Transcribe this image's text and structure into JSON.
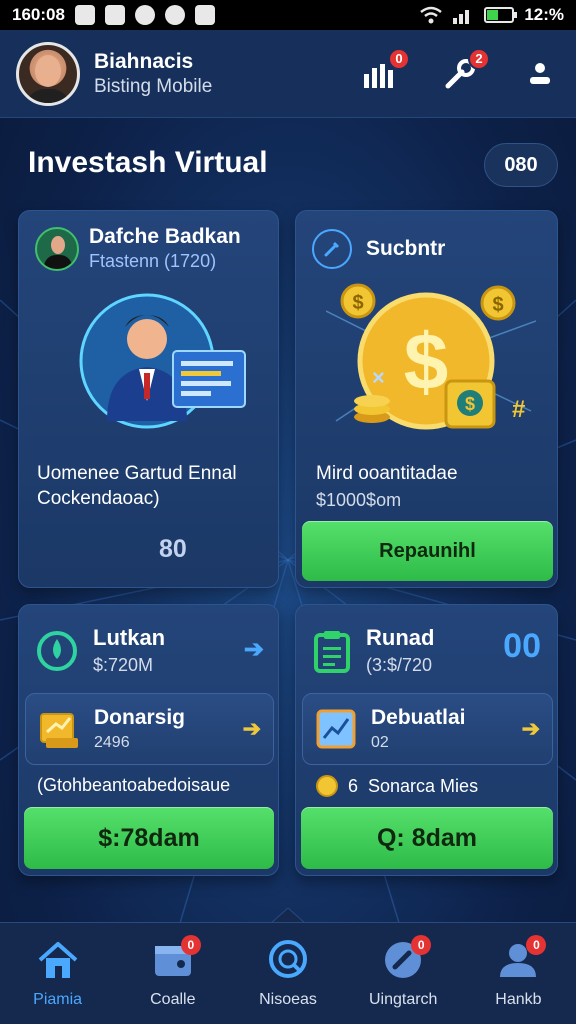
{
  "status_bar": {
    "time": "160:08",
    "battery": "12:%",
    "battery_level_percent": 50
  },
  "header": {
    "name": "Biahnacis",
    "subtitle": "Bisting Mobile",
    "stats_badge": "0",
    "tools_badge": "2",
    "icons": [
      "bar-chart-icon",
      "wrench-icon",
      "person-icon"
    ]
  },
  "page": {
    "title": "Investash Virtual",
    "pill": "080"
  },
  "card_profile": {
    "title": "Dafche Badkan",
    "subtitle": "Ftastenn (1720)",
    "desc_line1": "Uomenee Gartud Ennal",
    "desc_line2": "Cockendaoac)",
    "number": "80"
  },
  "card_subscribe": {
    "title": "Sucbntr",
    "desc": "Mird ooantitadae",
    "amount": "$1000$om",
    "button": "Repaunihl"
  },
  "card_lutkan": {
    "title": "Lutkan",
    "sub": "$:720M",
    "item_title": "Donarsig",
    "item_sub": "2496",
    "footer": "(Gtohbeantoabedoisaue",
    "button": "$:78dam"
  },
  "card_runad": {
    "title": "Runad",
    "sub": "(3:$/720",
    "counter": "00",
    "item_title": "Debuatlai",
    "item_sub": "02",
    "footer_coin": "6",
    "footer": "Sonarca Mies",
    "button": "Q: 8dam"
  },
  "nav": [
    {
      "label": "Piamia",
      "icon": "home-icon",
      "badge": ""
    },
    {
      "label": "Coalle",
      "icon": "wallet-icon",
      "badge": "0"
    },
    {
      "label": "Nisoeas",
      "icon": "search-icon",
      "badge": ""
    },
    {
      "label": "Uingtarch",
      "icon": "phone-icon",
      "badge": "0"
    },
    {
      "label": "Hankb",
      "icon": "user-icon",
      "badge": "0"
    }
  ],
  "colors": {
    "accent": "#4aa8ff",
    "green_button": "#3fcd55",
    "badge_red": "#e53232",
    "background": "#0e1f3d"
  }
}
